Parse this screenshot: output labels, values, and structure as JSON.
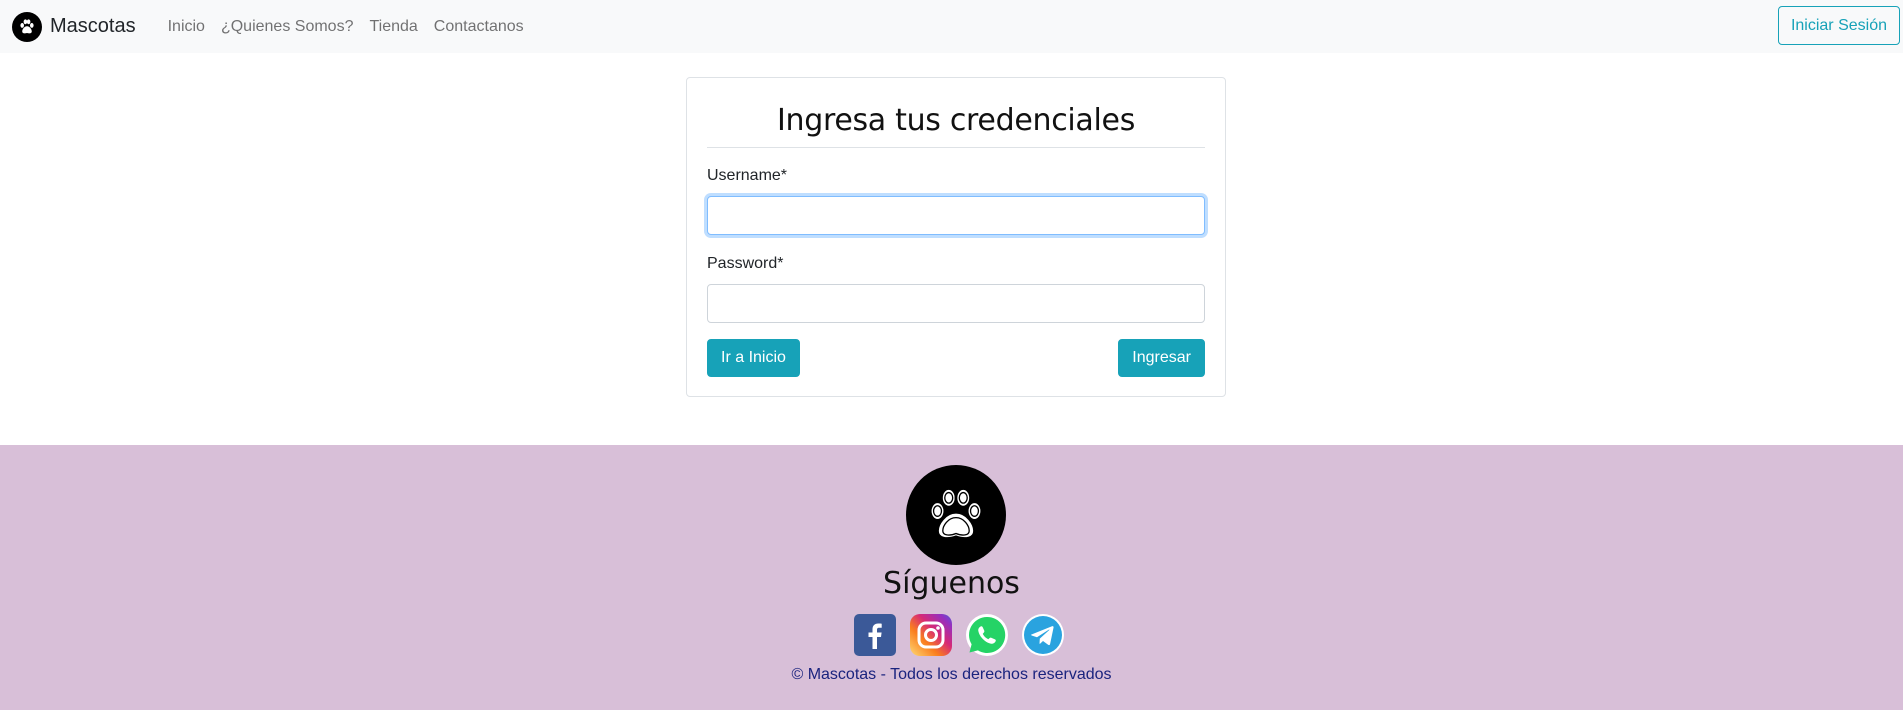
{
  "navbar": {
    "brand": "Mascotas",
    "links": [
      {
        "label": "Inicio"
      },
      {
        "label": "¿Quienes Somos?"
      },
      {
        "label": "Tienda"
      },
      {
        "label": "Contactanos"
      }
    ],
    "login_button": "Iniciar Sesión"
  },
  "login_form": {
    "title": "Ingresa tus credenciales",
    "username": {
      "label": "Username*",
      "value": "",
      "focused": true
    },
    "password": {
      "label": "Password*",
      "value": ""
    },
    "home_button": "Ir a Inicio",
    "submit_button": "Ingresar"
  },
  "footer": {
    "title": "Síguenos",
    "social_icons": [
      "facebook-icon",
      "instagram-icon",
      "whatsapp-icon",
      "telegram-icon"
    ],
    "copyright": "© Mascotas - Todos los derechos reservados"
  },
  "colors": {
    "navbar_bg": "#f8f9fa",
    "accent": "#17a2b8",
    "footer_bg": "#d8bfd8",
    "copyright_text": "#1a237e"
  }
}
